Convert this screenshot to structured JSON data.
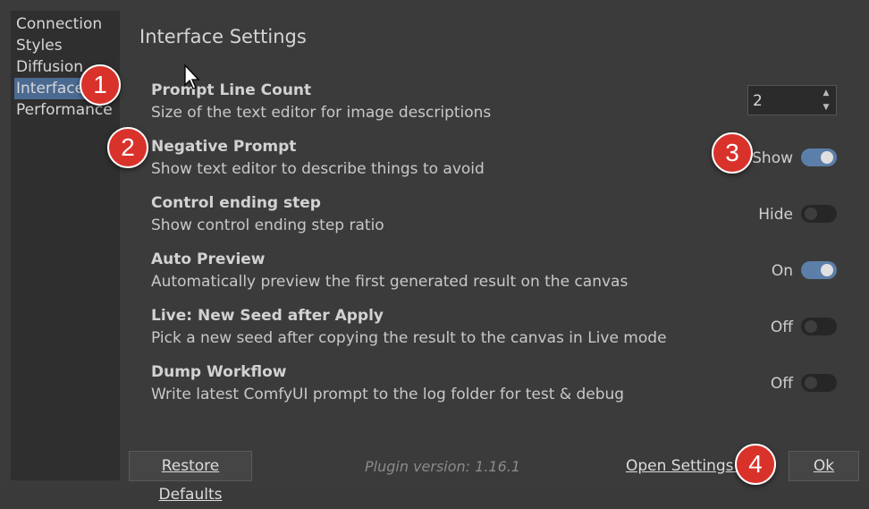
{
  "sidebar": {
    "items": [
      {
        "label": "Connection"
      },
      {
        "label": "Styles"
      },
      {
        "label": "Diffusion"
      },
      {
        "label": "Interface"
      },
      {
        "label": "Performance"
      }
    ],
    "active": "Interface"
  },
  "main": {
    "title": "Interface Settings",
    "settings": [
      {
        "title": "Prompt Line Count",
        "description": "Size of the text editor for image descriptions",
        "control": "spinbox",
        "value": "2"
      },
      {
        "title": "Negative Prompt",
        "description": "Show text editor to describe things to avoid",
        "control": "toggle",
        "state": "Show",
        "on": true
      },
      {
        "title": "Control ending step",
        "description": "Show control ending step ratio",
        "control": "toggle",
        "state": "Hide",
        "on": false
      },
      {
        "title": "Auto Preview",
        "description": "Automatically preview the first generated result on the canvas",
        "control": "toggle",
        "state": "On",
        "on": true
      },
      {
        "title": "Live: New Seed after Apply",
        "description": "Pick a new seed after copying the result to the canvas in Live mode",
        "control": "toggle",
        "state": "Off",
        "on": false
      },
      {
        "title": "Dump Workflow",
        "description": "Write latest ComfyUI prompt to the log folder for test & debug",
        "control": "toggle",
        "state": "Off",
        "on": false
      }
    ]
  },
  "footer": {
    "restore_label": "Restore Defaults",
    "plugin_version": "Plugin version: 1.16.1",
    "open_settings_label": "Open Settings f",
    "ok_label": "Ok"
  },
  "badges": [
    "1",
    "2",
    "3",
    "4"
  ],
  "colors": {
    "accent": "#5b7fa8",
    "badge": "#d9322b",
    "background": "#3b3b3b"
  }
}
